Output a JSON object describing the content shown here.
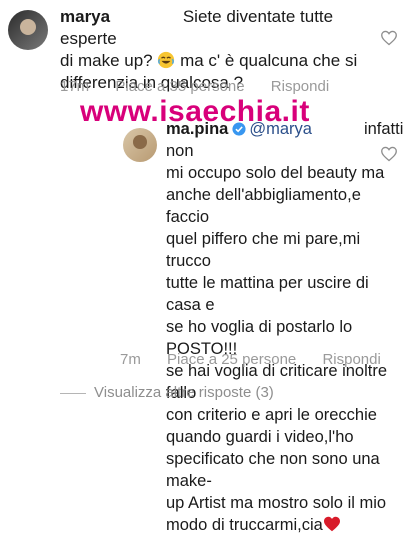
{
  "watermark": "www.isaechia.it",
  "comment": {
    "username": "marya",
    "line1": "Siete diventate tutte esperte",
    "line2_a": "di make up?",
    "line2_b": "ma c' è qualcuna che si",
    "line3": "differenzia in qualcosa ?",
    "time": "17m",
    "likes": "Piace a 35 persone",
    "reply": "Rispondi"
  },
  "reply_comment": {
    "username": "ma.pina",
    "mention": "@marya",
    "line1_tail": "infatti non",
    "lines": [
      "mi occupo solo del beauty ma",
      "anche dell'abbigliamento,e faccio",
      "quel piffero che mi pare,mi trucco",
      "tutte le mattina per uscire di casa e",
      "se ho voglia di postarlo lo POSTO!!!",
      "se hai voglia di criticare inoltre fallo",
      "con criterio e apri le orecchie",
      "quando guardi i video,l'ho",
      "specificato che non sono una make-",
      "up Artist ma mostro solo il mio"
    ],
    "last_line": "modo di truccarmi,cia",
    "time": "7m",
    "likes": "Piace a 25 persone",
    "reply": "Rispondi"
  },
  "view_more": "Visualizza altre risposte (3)",
  "colors": {
    "meta": "#9a9a9a",
    "mention": "#2b4f8a",
    "watermark": "#d8007a",
    "heart_emoji": "#d81b2a"
  }
}
